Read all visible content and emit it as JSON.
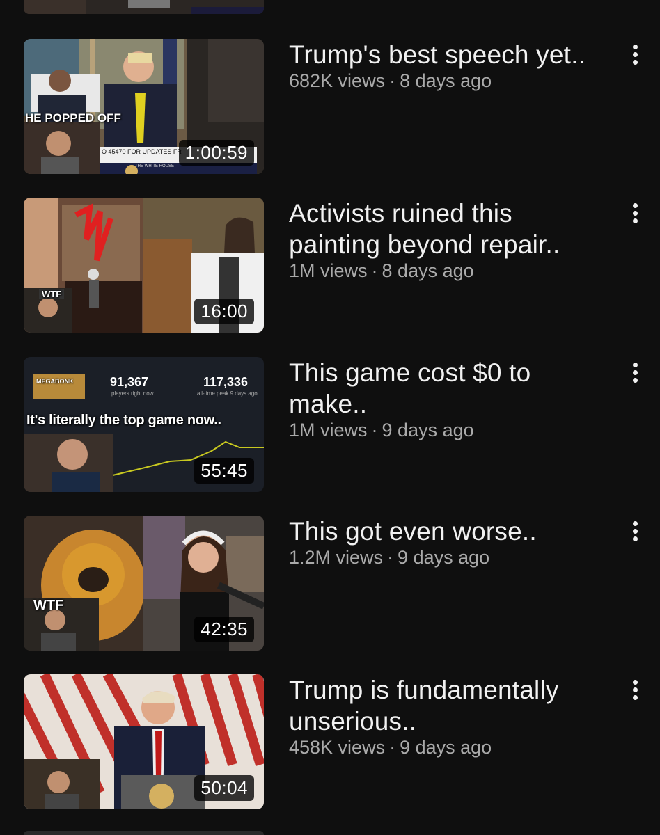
{
  "videos": [
    {
      "title": "Trump's best speech yet..",
      "views": "682K views",
      "age": "8 days ago",
      "duration": "1:00:59",
      "thumb_text": "HE POPPED OFF",
      "thumb_ticker": "O 45470 FOR UPDATES FR",
      "thumb_sign": "THE WHITE HOUSE"
    },
    {
      "title": "Activists ruined this painting beyond repair..",
      "views": "1M views",
      "age": "8 days ago",
      "duration": "16:00",
      "thumb_text": "WTF"
    },
    {
      "title": "This game cost $0 to make..",
      "views": "1M views",
      "age": "9 days ago",
      "duration": "55:45",
      "thumb_text": "It's literally the top game now..",
      "thumb_game": "MEGABONK",
      "thumb_players": "91,367",
      "thumb_players_label": "players right now",
      "thumb_peak": "117,336",
      "thumb_peak_label": "all-time peak 9 days ago"
    },
    {
      "title": "This got even worse..",
      "views": "1.2M views",
      "age": "9 days ago",
      "duration": "42:35",
      "thumb_text": "WTF"
    },
    {
      "title": "Trump is fundamentally unserious..",
      "views": "458K views",
      "age": "9 days ago",
      "duration": "50:04"
    }
  ],
  "colors": {
    "background": "#0f0f0f",
    "title": "#f1f1f1",
    "meta": "#aaaaaa"
  },
  "icons": {
    "more": "kebab-menu-icon"
  }
}
